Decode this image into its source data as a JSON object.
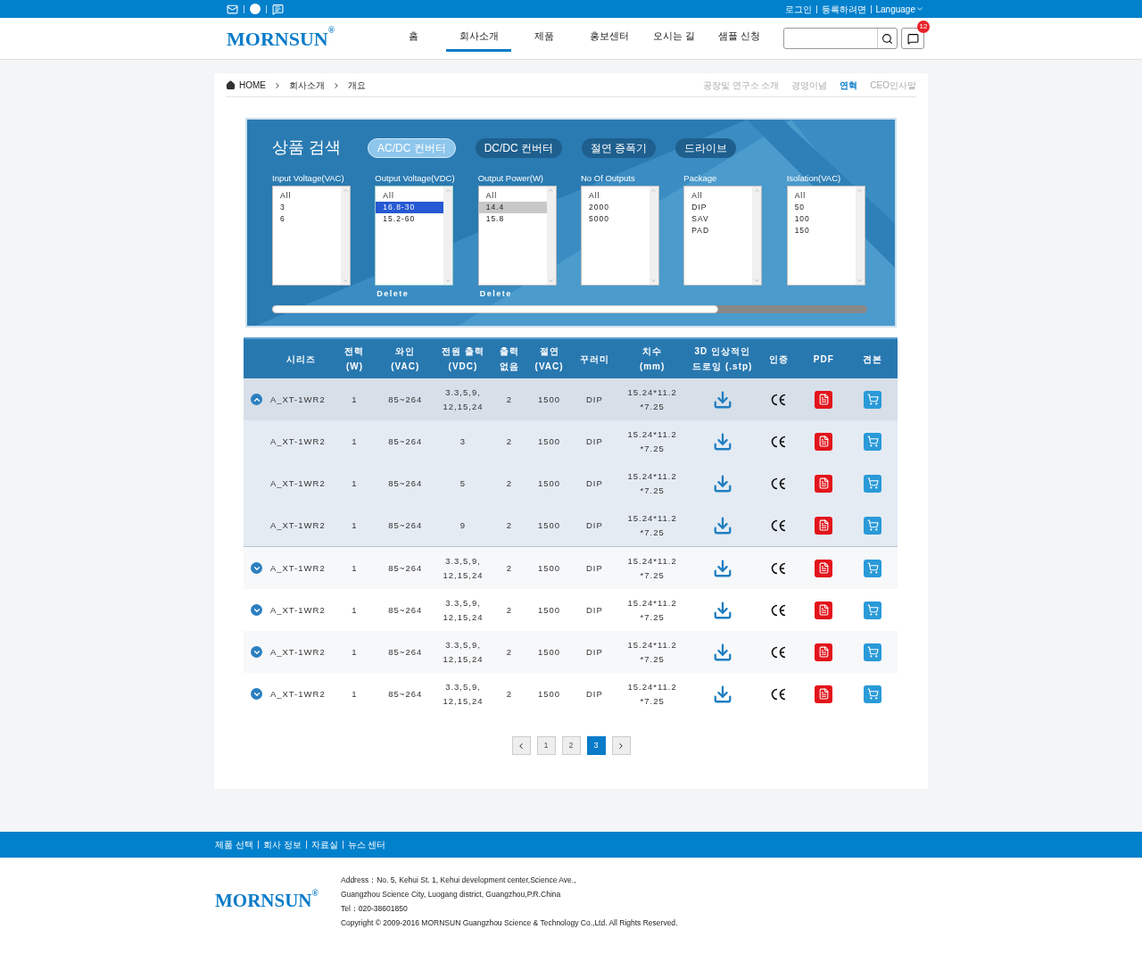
{
  "topbar": {
    "links": [
      "로그인",
      "등록하려면",
      "Language"
    ]
  },
  "header": {
    "logo": "MORNSUN",
    "logo_mark": "®",
    "nav": [
      {
        "label": "홈",
        "selected": false
      },
      {
        "label": "회사소개",
        "selected": true
      },
      {
        "label": "제품",
        "selected": false
      },
      {
        "label": "홍보센터",
        "selected": false
      },
      {
        "label": "오시는 길",
        "selected": false
      },
      {
        "label": "샘플 신청",
        "selected": false
      }
    ],
    "message_count": "12"
  },
  "breadcrumb": [
    "HOME",
    "회사소개",
    "개요"
  ],
  "subnav": [
    {
      "label": "공장및 연구소 소개",
      "selected": false
    },
    {
      "label": "경영이념",
      "selected": false
    },
    {
      "label": "연혁",
      "selected": true
    },
    {
      "label": "CEO인사말",
      "selected": false
    }
  ],
  "search": {
    "title": "상품 검색",
    "categories": [
      {
        "label": "AC/DC 컨버터",
        "selected": true
      },
      {
        "label": "DC/DC 컨버터",
        "selected": false
      },
      {
        "label": "절연 증폭기",
        "selected": false
      },
      {
        "label": "드라이브",
        "selected": false
      }
    ],
    "filters": [
      {
        "label": "Input Voltage(VAC)",
        "focused": false,
        "options": [
          {
            "label": "All",
            "selected": false
          },
          {
            "label": "3",
            "selected": false
          },
          {
            "label": "6",
            "selected": false
          }
        ]
      },
      {
        "label": "Output Voltage(VDC)",
        "focused": true,
        "delete": "Delete",
        "options": [
          {
            "label": "All",
            "selected": false
          },
          {
            "label": "16.8-30",
            "selected": true
          },
          {
            "label": "15.2-60",
            "selected": false
          }
        ]
      },
      {
        "label": "Output Power(W)",
        "focused": false,
        "delete": "Delete",
        "options": [
          {
            "label": "All",
            "selected": false
          },
          {
            "label": "14.4",
            "selected": true
          },
          {
            "label": "15.8",
            "selected": false
          }
        ]
      },
      {
        "label": "No Of Outputs",
        "focused": false,
        "options": [
          {
            "label": "All",
            "selected": false
          },
          {
            "label": "2000",
            "selected": false
          },
          {
            "label": "5000",
            "selected": false
          }
        ]
      },
      {
        "label": "Package",
        "focused": false,
        "options": [
          {
            "label": "All",
            "selected": false
          },
          {
            "label": "DIP",
            "selected": false
          },
          {
            "label": "SAV",
            "selected": false
          },
          {
            "label": "PAD",
            "selected": false
          }
        ]
      },
      {
        "label": "Isolation(VAC)",
        "focused": false,
        "options": [
          {
            "label": "All",
            "selected": false
          },
          {
            "label": "50",
            "selected": false
          },
          {
            "label": "100",
            "selected": false
          },
          {
            "label": "150",
            "selected": false
          }
        ]
      }
    ]
  },
  "table": {
    "columns": [
      "시리즈",
      "전력\n(W)",
      "와인\n(VAC)",
      "전원 출력\n(VDC)",
      "출력\n없음",
      "절연\n(VAC)",
      "꾸러미",
      "치수\n(mm)",
      "3D 인상적인\n드로잉 (.stp)",
      "인증",
      "PDF",
      "견본"
    ],
    "rows": [
      {
        "cells": [
          "A_XT-1WR2",
          "1",
          "85~264",
          "3.3,5,9,\n12,15,24",
          "2",
          "1500",
          "DIP",
          "15.24*11.2\n*7.25"
        ],
        "expanded": true,
        "children": [
          {
            "cells": [
              "A_XT-1WR2",
              "1",
              "85~264",
              "3",
              "2",
              "1500",
              "DIP",
              "15.24*11.2\n*7.25"
            ]
          },
          {
            "cells": [
              "A_XT-1WR2",
              "1",
              "85~264",
              "5",
              "2",
              "1500",
              "DIP",
              "15.24*11.2\n*7.25"
            ]
          },
          {
            "cells": [
              "A_XT-1WR2",
              "1",
              "85~264",
              "9",
              "2",
              "1500",
              "DIP",
              "15.24*11.2\n*7.25"
            ]
          }
        ]
      },
      {
        "cells": [
          "A_XT-1WR2",
          "1",
          "85~264",
          "3.3,5,9,\n12,15,24",
          "2",
          "1500",
          "DIP",
          "15.24*11.2\n*7.25"
        ],
        "expanded": false
      },
      {
        "cells": [
          "A_XT-1WR2",
          "1",
          "85~264",
          "3.3,5,9,\n12,15,24",
          "2",
          "1500",
          "DIP",
          "15.24*11.2\n*7.25"
        ],
        "expanded": false
      },
      {
        "cells": [
          "A_XT-1WR2",
          "1",
          "85~264",
          "3.3,5,9,\n12,15,24",
          "2",
          "1500",
          "DIP",
          "15.24*11.2\n*7.25"
        ],
        "expanded": false
      },
      {
        "cells": [
          "A_XT-1WR2",
          "1",
          "85~264",
          "3.3,5,9,\n12,15,24",
          "2",
          "1500",
          "DIP",
          "15.24*11.2\n*7.25"
        ],
        "expanded": false
      }
    ]
  },
  "pagination": [
    {
      "label": "1",
      "selected": false
    },
    {
      "label": "2",
      "selected": false
    },
    {
      "label": "3",
      "selected": true
    }
  ],
  "footer": {
    "links": [
      "제품 선택",
      "회사 정보",
      "자료실",
      "뉴스 센터"
    ],
    "logo": "MORNSUN",
    "logo_mark": "®",
    "lines": [
      "Address：No. 5, Kehui St. 1, Kehui development center,Science Ave.,",
      "Guangzhou Science City, Luogang district, Guangzhou,P.R.China",
      "Tel：020-38601850",
      "Copyright © 2009-2016 MORNSUN Guangzhou Science & Technology Co.,Ltd. All Rights Reserved."
    ]
  }
}
